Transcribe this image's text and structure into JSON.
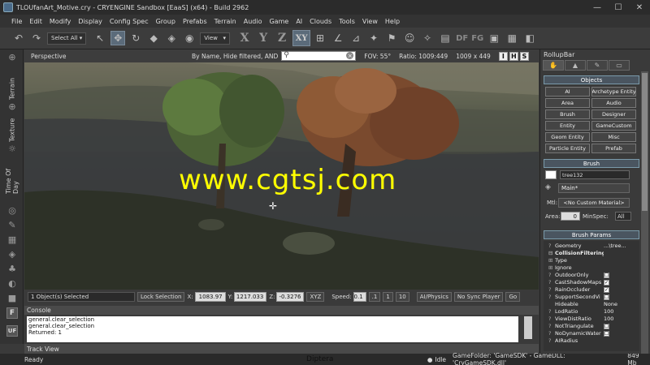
{
  "window": {
    "title": "TLOUfanArt_Motive.cry - CRYENGINE Sandbox [EaaS] (x64) - Build 2962",
    "controls": [
      "—",
      "☐",
      "✕"
    ]
  },
  "menu": [
    "File",
    "Edit",
    "Modify",
    "Display",
    "Config Spec",
    "Group",
    "Prefabs",
    "Terrain",
    "Audio",
    "Game",
    "AI",
    "Clouds",
    "Tools",
    "View",
    "Help"
  ],
  "toolbar": {
    "select_all": "Select All",
    "coord_system": "View",
    "axes": [
      "X",
      "Y",
      "Z",
      "XY"
    ],
    "df_label": "DF",
    "fg_label": "FG"
  },
  "left_tabs": [
    "Terrain",
    "Texture",
    "Time Of Day"
  ],
  "left_boxes": [
    "F",
    "UF"
  ],
  "viewport": {
    "title": "Perspective",
    "filter": "By Name, Hide filtered, AND",
    "search_value": "",
    "fov": "FOV:  55°",
    "ratio": "Ratio: 1009:449",
    "size": "1009 x 449",
    "buttons": [
      "I",
      "H",
      "S"
    ],
    "watermark": "www.cgtsj.com"
  },
  "status_strip": {
    "selected": "1 Object(s) Selected",
    "lock_selection": "Lock Selection",
    "x_label": "X:",
    "x": "1083.97",
    "y_label": "Y:",
    "y": "1217.033",
    "z_label": "Z:",
    "z": "-0.3276",
    "xyz": "XYZ",
    "speed_label": "Speed:",
    "speed": "0.1",
    "speed_options": [
      ".1",
      "1",
      "10"
    ],
    "ai_physics": "AI/Physics",
    "no_sync": "No Sync Player",
    "go": "Go"
  },
  "console": {
    "title": "Console",
    "lines": [
      "general.clear_selection",
      "general.clear_selection",
      "Returned: 1"
    ]
  },
  "track_view": {
    "title": "Track View"
  },
  "statusbar": {
    "ready": "Ready",
    "center": "Diptera",
    "idle": "Idle",
    "game_folder": "GameFolder: 'GameSDK' - GameDLL: 'CryGameSDK.dll'",
    "memory": "849 Mb"
  },
  "rollupbar": {
    "title": "RollupBar",
    "objects_header": "Objects",
    "object_buttons": [
      "AI",
      "Archetype Entity",
      "Area",
      "Audio",
      "Brush",
      "Designer",
      "Entity",
      "GameCustom",
      "Geom Entity",
      "Misc",
      "Particle Entity",
      "Prefab"
    ],
    "brush_header": "Brush",
    "brush_name": "tree132",
    "layer": "Main*",
    "mtl_label": "Mtl:",
    "material": "<No Custom Material>",
    "area_label": "Area:",
    "area_value": "0",
    "minspec_label": "MinSpec:",
    "minspec_value": "All",
    "params_header": "Brush Params",
    "params": [
      {
        "name": "Geometry",
        "value": "...\\tree...",
        "check": ""
      },
      {
        "name": "CollisionFiltering",
        "value": "",
        "check": ""
      },
      {
        "name": "Type",
        "value": "",
        "check": ""
      },
      {
        "name": "Ignore",
        "value": "",
        "check": ""
      },
      {
        "name": "OutdoorOnly",
        "value": "",
        "check": "☐"
      },
      {
        "name": "CastShadowMaps",
        "value": "",
        "check": "✓"
      },
      {
        "name": "RainOccluder",
        "value": "",
        "check": "✓"
      },
      {
        "name": "SupportSecondVi",
        "value": "",
        "check": "☐"
      },
      {
        "name": "Hideable",
        "value": "None",
        "check": ""
      },
      {
        "name": "LodRatio",
        "value": "100",
        "check": ""
      },
      {
        "name": "ViewDistRatio",
        "value": "100",
        "check": ""
      },
      {
        "name": "NotTriangulate",
        "value": "",
        "check": "☐"
      },
      {
        "name": "NoDynamicWater",
        "value": "",
        "check": "☐"
      },
      {
        "name": "AIRadius",
        "value": "",
        "check": ""
      }
    ]
  },
  "colors": {
    "section_bg": "#4a5560",
    "watermark": "#ffff00",
    "active_tool": "#5b6b7a"
  }
}
